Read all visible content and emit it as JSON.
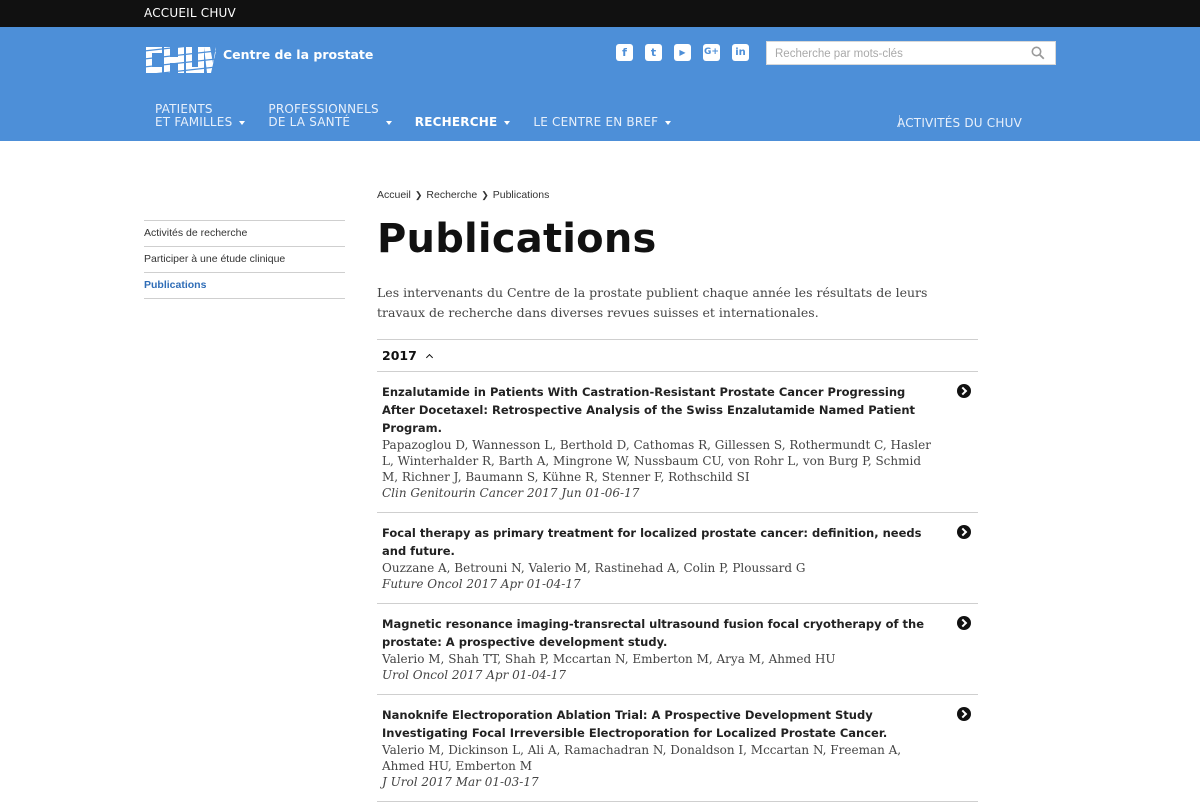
{
  "topbar": {
    "link": "ACCUEIL CHUV"
  },
  "header": {
    "logo_text": "CHUV",
    "site_name": "Centre de la prostate",
    "social": [
      {
        "icon": "facebook-icon",
        "glyph": "f"
      },
      {
        "icon": "twitter-icon",
        "glyph": "t"
      },
      {
        "icon": "youtube-icon",
        "glyph": "▶"
      },
      {
        "icon": "googleplus-icon",
        "glyph": "G+"
      },
      {
        "icon": "linkedin-icon",
        "glyph": "in"
      }
    ],
    "search_placeholder": "Recherche par mots-clés",
    "brand_color": "#4d8fd8"
  },
  "nav": {
    "items": [
      {
        "line1": "PATIENTS",
        "line2": "ET FAMILLES"
      },
      {
        "line1": "PROFESSIONNELS",
        "line2": "DE LA SANTÉ"
      },
      {
        "line1": "",
        "line2": "RECHERCHE",
        "active": true
      },
      {
        "line1": "",
        "line2": "LE CENTRE EN BREF"
      }
    ],
    "right": "ACTIVITÉS DU CHUV"
  },
  "sidebar": {
    "items": [
      {
        "label": "Activités de recherche"
      },
      {
        "label": "Participer à une étude clinique"
      },
      {
        "label": "Publications",
        "active": true
      }
    ]
  },
  "breadcrumb": [
    "Accueil",
    "Recherche",
    "Publications"
  ],
  "page": {
    "title": "Publications",
    "intro": "Les intervenants du Centre de la prostate publient chaque année les résultats de leurs travaux de recherche dans diverses revues suisses et internationales."
  },
  "year": "2017",
  "publications": [
    {
      "title": "Enzalutamide in Patients With Castration-Resistant Prostate Cancer Progressing After Docetaxel: Retrospective Analysis of the Swiss Enzalutamide Named Patient Program.",
      "authors": "Papazoglou D, Wannesson L, Berthold D, Cathomas R, Gillessen S, Rothermundt C, Hasler L, Winterhalder R, Barth A, Mingrone W, Nussbaum CU, von Rohr L, von Burg P, Schmid M, Richner J, Baumann S, Kühne R, Stenner F, Rothschild SI",
      "ref": "Clin Genitourin Cancer 2017 Jun 01-06-17"
    },
    {
      "title": "Focal therapy as primary treatment for localized prostate cancer: definition, needs and future.",
      "authors": "Ouzzane A, Betrouni N, Valerio M, Rastinehad A, Colin P, Ploussard G",
      "ref": "Future Oncol 2017 Apr 01-04-17"
    },
    {
      "title": "Magnetic resonance imaging-transrectal ultrasound fusion focal cryotherapy of the prostate: A prospective development study.",
      "authors": "Valerio M, Shah TT, Shah P, Mccartan N, Emberton M, Arya M, Ahmed HU",
      "ref": "Urol Oncol 2017 Apr 01-04-17"
    },
    {
      "title": "Nanoknife Electroporation Ablation Trial: A Prospective Development Study Investigating Focal Irreversible Electroporation for Localized Prostate Cancer.",
      "authors": "Valerio M, Dickinson L, Ali A, Ramachadran N, Donaldson I, Mccartan N, Freeman A, Ahmed HU, Emberton M",
      "ref": "J Urol 2017 Mar 01-03-17"
    }
  ]
}
